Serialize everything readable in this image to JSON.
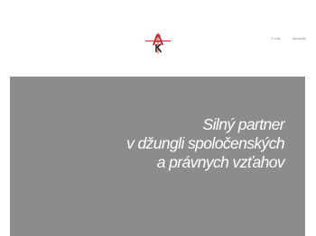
{
  "brand": {
    "logo_icon": "ak-monogram-logo-icon",
    "accent_color": "#d4242c",
    "dark_color": "#2a2a2a"
  },
  "nav": {
    "items": [
      {
        "label": "O nás"
      },
      {
        "label": "Aktuality"
      }
    ]
  },
  "hero": {
    "background_color": "#8c8c8c",
    "tagline": [
      "Silný partner",
      "v džungli spoločenských",
      "a právnych vzťahov"
    ]
  }
}
